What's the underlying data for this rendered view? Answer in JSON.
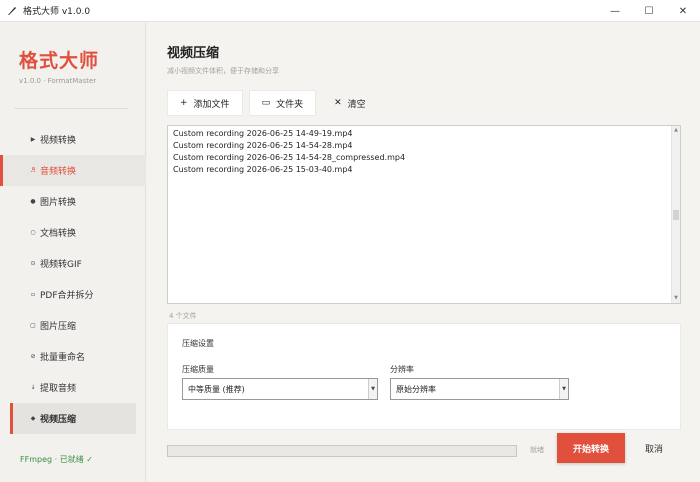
{
  "window": {
    "title": "格式大师 v1.0.0",
    "controls": {
      "minimize": "—",
      "maximize": "☐",
      "close": "✕"
    }
  },
  "sidebar": {
    "brand": "格式大师",
    "version": "v1.0.0 · FormatMaster",
    "items": [
      {
        "label": "视频转换",
        "icon": "▶"
      },
      {
        "label": "音频转换",
        "icon": "♬"
      },
      {
        "label": "图片转换",
        "icon": "●"
      },
      {
        "label": "文档转换",
        "icon": "○"
      },
      {
        "label": "视频转GIF",
        "icon": "⊙"
      },
      {
        "label": "PDF合并拆分",
        "icon": "▫"
      },
      {
        "label": "图片压缩",
        "icon": "▢"
      },
      {
        "label": "批量重命名",
        "icon": "⊘"
      },
      {
        "label": "提取音频",
        "icon": "↓"
      },
      {
        "label": "视频压缩",
        "icon": "◆"
      }
    ],
    "status": "FFmpeg · 已就绪 ✓"
  },
  "main": {
    "title": "视频压缩",
    "subtitle": "减小视频文件体积，便于存储和分享",
    "toolbar": {
      "add_files": "添加文件",
      "add_files_icon": "+",
      "folder": "文件夹",
      "folder_icon": "▭",
      "clear": "清空",
      "clear_icon": "✕"
    },
    "files": [
      "Custom recording 2026-06-25 14-49-19.mp4",
      "Custom recording 2026-06-25 14-54-28.mp4",
      "Custom recording 2026-06-25 14-54-28_compressed.mp4",
      "Custom recording 2026-06-25 15-03-40.mp4"
    ],
    "file_count": "4 个文件",
    "settings": {
      "title": "压缩设置",
      "quality_label": "压缩质量",
      "quality_value": "中等质量 (推荐)",
      "resolution_label": "分辨率",
      "resolution_value": "原始分辨率"
    },
    "progress": 0,
    "ready_text": "就绪",
    "start_button": "开始转换",
    "cancel_button": "取消"
  },
  "colors": {
    "accent": "#e0503c",
    "ok": "#3a8f46"
  }
}
